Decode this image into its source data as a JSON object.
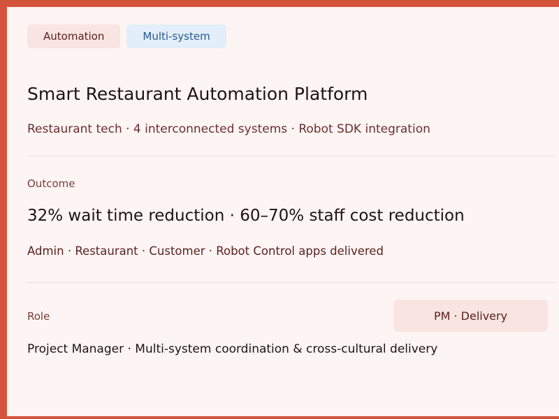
{
  "tags": [
    {
      "label": "Automation"
    },
    {
      "label": "Multi-system"
    }
  ],
  "project": {
    "title": "Smart Restaurant Automation Platform",
    "subtitle": "Restaurant tech · 4 interconnected systems · Robot SDK integration"
  },
  "outcome": {
    "label": "Outcome",
    "headline": "32% wait time reduction · 60–70% staff cost reduction",
    "detail": "Admin · Restaurant · Customer · Robot Control apps delivered"
  },
  "role": {
    "label": "Role",
    "badge": "PM · Delivery",
    "description": "Project Manager · Multi-system coordination & cross-cultural delivery"
  },
  "colors": {
    "frame": "#d4533b",
    "card_bg": "#fdf5f4",
    "tag_warm_bg": "#f8e4e0",
    "tag_blue_bg": "#e2eef9"
  }
}
